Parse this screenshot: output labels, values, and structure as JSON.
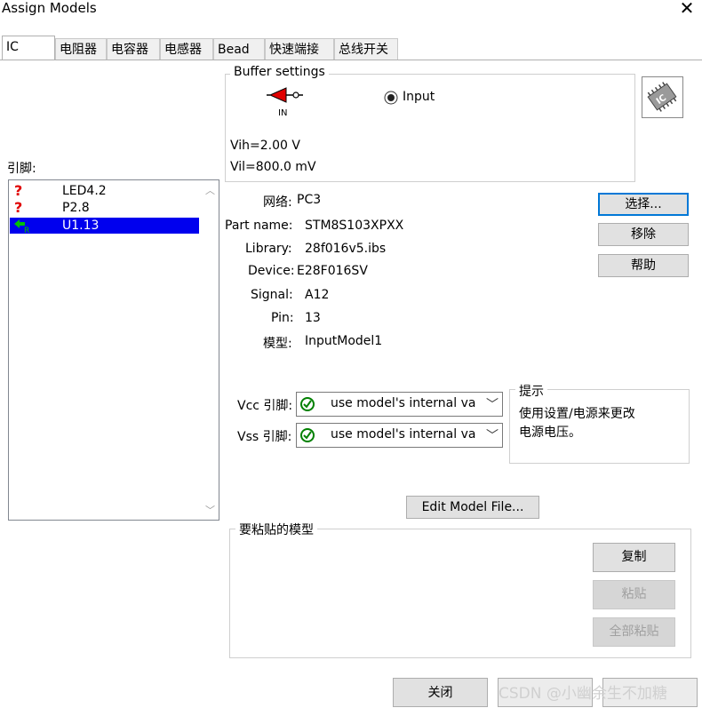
{
  "window": {
    "title": "Assign Models"
  },
  "tabs": [
    {
      "label": "IC"
    },
    {
      "label": "电阻器"
    },
    {
      "label": "电容器"
    },
    {
      "label": "电感器"
    },
    {
      "label": "Bead"
    },
    {
      "label": "快速端接"
    },
    {
      "label": "总线开关"
    }
  ],
  "pins": {
    "label": "引脚:",
    "items": [
      {
        "label": "LED4.2",
        "status": "unknown"
      },
      {
        "label": "P2.8",
        "status": "unknown"
      },
      {
        "label": "U1.13",
        "status": "receiver",
        "selected": true
      }
    ]
  },
  "buffer": {
    "legend": "Buffer settings",
    "symbol_label": "IN",
    "radio_label": "Input",
    "vih": "Vih=2.00 V",
    "vil": "Vil=800.0 mV"
  },
  "details": {
    "net_label": "网络:",
    "net_value": "PC3",
    "part_label": "Part name:",
    "part_value": "STM8S103XPXX",
    "library_label": "Library:",
    "library_value": "28f016v5.ibs",
    "device_label": "Device:",
    "device_value": "E28F016SV",
    "signal_label": "Signal:",
    "signal_value": "A12",
    "pin_label": "Pin:",
    "pin_value": "13",
    "model_label": "模型:",
    "model_value": "InputModel1"
  },
  "buttons": {
    "select": "选择...",
    "remove": "移除",
    "help": "帮助",
    "edit_model": "Edit Model File...",
    "copy": "复制",
    "paste": "粘贴",
    "paste_all": "全部粘贴",
    "close": "关闭"
  },
  "vcc": {
    "label": "Vcc 引脚:",
    "value": "use model's internal va"
  },
  "vss": {
    "label": "Vss 引脚:",
    "value": "use model's internal va"
  },
  "hint": {
    "legend": "提示",
    "text1": "使用设置/电源来更改",
    "text2": "电源电压。"
  },
  "paste_group": {
    "legend": "要粘贴的模型"
  },
  "watermark": "CSDN @小幽余生不加糖",
  "colors": {
    "selection": "#0000ee",
    "error_icon": "#e00000",
    "receiver_icon": "#00a000",
    "accent": "#0078d7"
  }
}
